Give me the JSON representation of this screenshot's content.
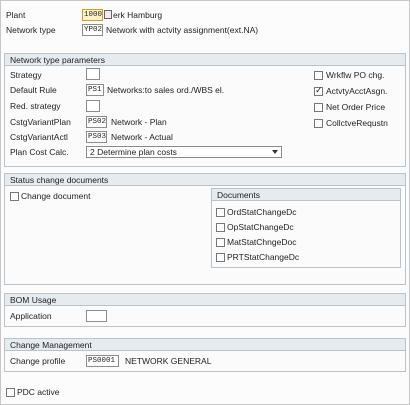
{
  "header": {
    "plant_label": "Plant",
    "plant_value": "1000",
    "plant_desc": "erk Hamburg",
    "network_type_label": "Network type",
    "network_type_value": "YP02",
    "network_type_desc": "Network with actvity assignment(ext.NA)"
  },
  "network_params": {
    "title": "Network type parameters",
    "strategy_label": "Strategy",
    "strategy_value": "",
    "default_rule_label": "Default Rule",
    "default_rule_value": "PS1",
    "default_rule_desc": "Networks:to sales ord./WBS el.",
    "red_strategy_label": "Red. strategy",
    "red_strategy_value": "",
    "cstg_plan_label": "CstgVariantPlan",
    "cstg_plan_value": "PS02",
    "cstg_plan_desc": "Network - Plan",
    "cstg_actl_label": "CstgVariantActl",
    "cstg_actl_value": "PS03",
    "cstg_actl_desc": "Network - Actual",
    "plan_cost_label": "Plan Cost Calc.",
    "plan_cost_value": "2 Determine plan costs",
    "checkboxes": [
      {
        "label": "Wrkflw PO chg.",
        "checked": false
      },
      {
        "label": "ActvtyAcctAsgn.",
        "checked": true
      },
      {
        "label": "Net Order Price",
        "checked": false
      },
      {
        "label": "CollctveRequstn",
        "checked": false
      }
    ]
  },
  "status_change": {
    "title": "Status change documents",
    "change_doc_label": "Change document",
    "documents_title": "Documents",
    "documents": [
      {
        "label": "OrdStatChangeDc",
        "checked": false
      },
      {
        "label": "OpStatChangeDc",
        "checked": false
      },
      {
        "label": "MatStatChngeDoc",
        "checked": false
      },
      {
        "label": "PRTStatChangeDc",
        "checked": false
      }
    ]
  },
  "bom_usage": {
    "title": "BOM Usage",
    "application_label": "Application",
    "application_value": ""
  },
  "change_mgmt": {
    "title": "Change Management",
    "change_profile_label": "Change profile",
    "change_profile_value": "PS0001",
    "change_profile_desc": "NETWORK GENERAL"
  },
  "footer": {
    "pdc_label": "PDC active"
  }
}
